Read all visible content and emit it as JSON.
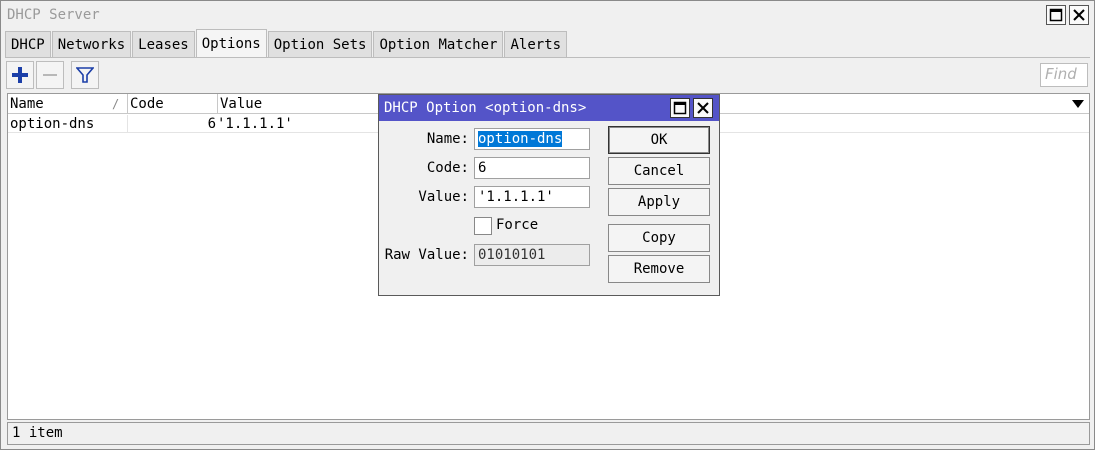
{
  "window": {
    "title": "DHCP Server"
  },
  "tabs": [
    {
      "label": "DHCP",
      "active": false
    },
    {
      "label": "Networks",
      "active": false
    },
    {
      "label": "Leases",
      "active": false
    },
    {
      "label": "Options",
      "active": true
    },
    {
      "label": "Option Sets",
      "active": false
    },
    {
      "label": "Option Matcher",
      "active": false
    },
    {
      "label": "Alerts",
      "active": false
    }
  ],
  "toolbar": {
    "add_icon": "plus-icon",
    "remove_icon": "minus-icon",
    "filter_icon": "filter-icon",
    "find_placeholder": "Find"
  },
  "table": {
    "columns": [
      "Name",
      "Code",
      "Value"
    ],
    "sort_indicator": "/",
    "rows": [
      {
        "name": "option-dns",
        "code": "6",
        "value": "'1.1.1.1'"
      }
    ]
  },
  "status": {
    "text": "1 item"
  },
  "dialog": {
    "title": "DHCP Option <option-dns>",
    "name_label": "Name:",
    "name_value": "option-dns",
    "code_label": "Code:",
    "code_value": "6",
    "value_label": "Value:",
    "value_value": "'1.1.1.1'",
    "force_label": "Force",
    "force_checked": false,
    "raw_label": "Raw Value:",
    "raw_value": "01010101",
    "buttons": {
      "ok": "OK",
      "cancel": "Cancel",
      "apply": "Apply",
      "copy": "Copy",
      "remove": "Remove"
    }
  },
  "colors": {
    "dialog_title_bg": "#5454c8",
    "selection_bg": "#0078d7",
    "add_icon": "#1c3fa8"
  }
}
